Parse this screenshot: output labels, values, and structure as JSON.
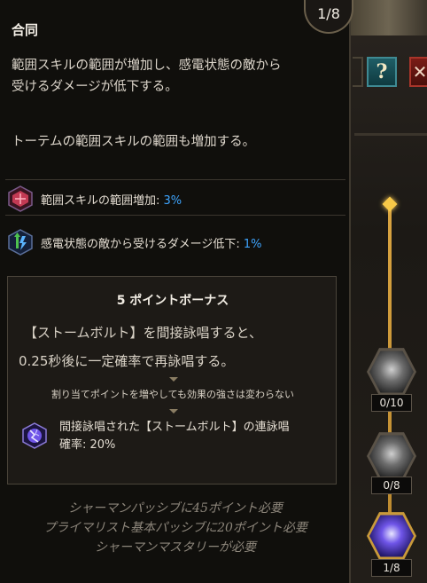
{
  "tooltip": {
    "title": "合同",
    "counter": "1/8",
    "description": "範囲スキルの範囲が増加し、感電状態の敵から\n受けるダメージが低下する。",
    "description_2": "トーテムの範囲スキルの範囲も増加する。",
    "stats": [
      {
        "icon": "area-icon",
        "label": "範囲スキルの範囲増加:",
        "value": "3%"
      },
      {
        "icon": "shock-defense-icon",
        "label": "感電状態の敵から受けるダメージ低下:",
        "value": "1%"
      }
    ],
    "bonus": {
      "title": "5 ポイントボーナス",
      "line1": "【ストームボルト】を間接詠唱すると、",
      "line2": "0.25秒後に一定確率で再詠唱する。",
      "note": "割り当てポイントを増やしても効果の強さは変わらない",
      "skill_icon": "storm-bolt-icon",
      "skill_line1": "間接詠唱された【ストームボルト】の連詠唱",
      "skill_line2": "確率: 20%"
    },
    "requirements": [
      "シャーマンパッシブに45ポイント必要",
      "プライマリスト基本パッシブに20ポイント必要",
      "シャーマンマスタリーが必要"
    ]
  },
  "background": {
    "help_label": "?",
    "close_label": "✕",
    "nodes": [
      {
        "icon": "node-claw-icon",
        "count": "0/10"
      },
      {
        "icon": "node-hand-icon",
        "count": "0/8"
      },
      {
        "icon": "node-storm-icon",
        "count": "1/8"
      }
    ]
  },
  "colors": {
    "accent_value": "#3ea5ff",
    "track": "#d9a441"
  }
}
